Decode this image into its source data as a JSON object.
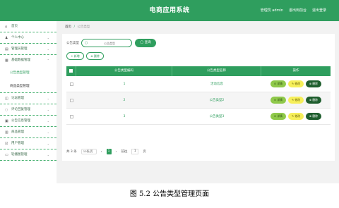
{
  "header": {
    "title": "电商应用系统",
    "links": [
      "管理员 admin",
      "退出到前台",
      "退出登录"
    ]
  },
  "sidebar": {
    "items": [
      {
        "icon": "home-icon",
        "glyph": "⌂",
        "label": "首页",
        "chev": ""
      },
      {
        "icon": "user-icon",
        "glyph": "♟",
        "label": "个人中心",
        "chev": "⌄"
      },
      {
        "icon": "admin-icon",
        "glyph": "▤",
        "label": "管理员管理",
        "chev": "⌄"
      },
      {
        "icon": "data-icon",
        "glyph": "▦",
        "label": "基础数据管理",
        "chev": "⌃"
      }
    ],
    "submenus": [
      "公告类型管理",
      "商品类型管理"
    ],
    "items2": [
      {
        "icon": "notice-icon",
        "glyph": "◫",
        "label": "论坛管理",
        "chev": "⌄"
      },
      {
        "icon": "feedback-icon",
        "glyph": "◌",
        "label": "评论回复管理",
        "chev": "⌄"
      },
      {
        "icon": "announcement-icon",
        "glyph": "▣",
        "label": "公告信息管理",
        "chev": "⌄"
      },
      {
        "icon": "product-icon",
        "glyph": "▥",
        "label": "商品管理",
        "chev": "⌄"
      },
      {
        "icon": "customer-icon",
        "glyph": "☑",
        "label": "用户管理",
        "chev": "⌄"
      },
      {
        "icon": "carousel-icon",
        "glyph": "▭",
        "label": "轮播图管理",
        "chev": "⌄"
      }
    ]
  },
  "breadcrumb": {
    "home": "首页",
    "sep": "/",
    "current": "公告类型"
  },
  "search": {
    "label": "公告类型",
    "placeholder": "公告类型",
    "button": "查询"
  },
  "actions": {
    "add": "+ 新增",
    "delete": "删除"
  },
  "table": {
    "columns": [
      "公告类型编码",
      "公告类型名称",
      "操作"
    ],
    "rows": [
      {
        "code": "1",
        "name": "活动信息"
      },
      {
        "code": "2",
        "name": "公告类型2"
      },
      {
        "code": "3",
        "name": "公告类型3"
      }
    ],
    "ops": {
      "detail": "详情",
      "edit": "修改",
      "del": "删除"
    }
  },
  "pager": {
    "total": "共 3 条",
    "size": "10条/页",
    "prev": "‹",
    "page": "1",
    "next": "›",
    "goto_label": "前往",
    "goto_value": "1",
    "goto_unit": "页"
  },
  "caption": "图 5.2  公告类型管理页面"
}
